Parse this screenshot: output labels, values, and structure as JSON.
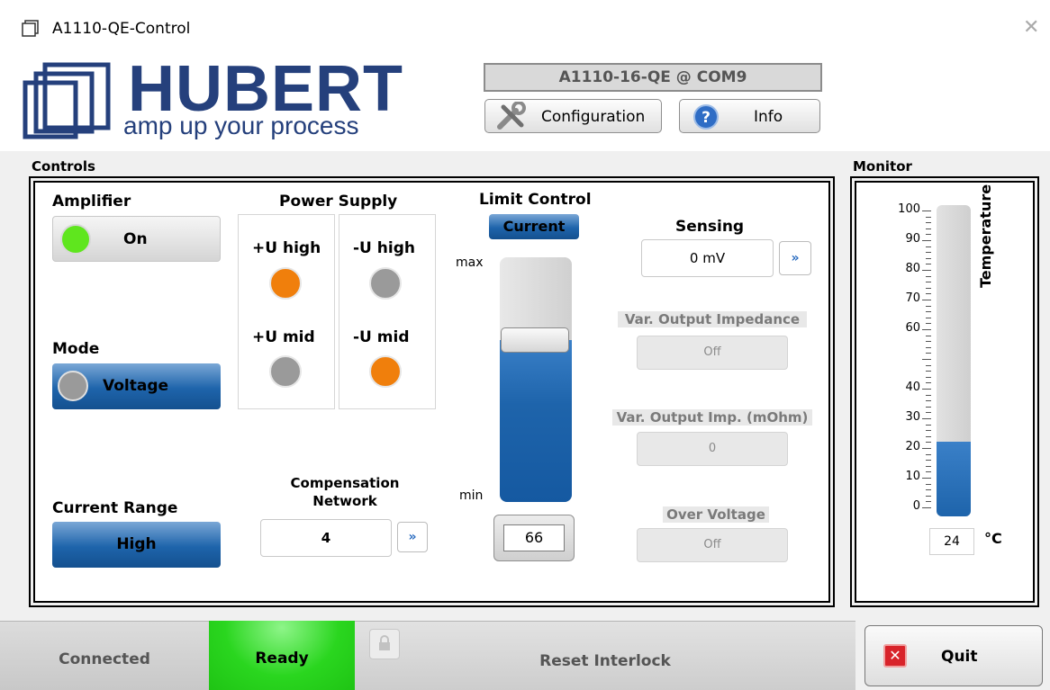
{
  "window": {
    "title": "A1110-QE-Control"
  },
  "brand": {
    "name": "HUBERT",
    "tagline": "amp up your process"
  },
  "header": {
    "device": "A1110-16-QE @ COM9",
    "config_label": "Configuration",
    "info_label": "Info"
  },
  "controls": {
    "section_label": "Controls",
    "amplifier": {
      "label": "Amplifier",
      "button": "On",
      "led_color": "#5fe61e"
    },
    "mode": {
      "label": "Mode",
      "button": "Voltage",
      "led_color": "#9a9a9a"
    },
    "current_range": {
      "label": "Current Range",
      "button": "High"
    },
    "power_supply": {
      "label": "Power Supply",
      "items": [
        {
          "label": "+U high",
          "color": "#f07f0c"
        },
        {
          "label": "-U high",
          "color": "#9a9a9a"
        },
        {
          "label": "+U mid",
          "color": "#9a9a9a"
        },
        {
          "label": "-U mid",
          "color": "#f07f0c"
        }
      ]
    },
    "compensation": {
      "label_line1": "Compensation",
      "label_line2": "Network",
      "value": "4"
    },
    "limit_control": {
      "label": "Limit Control",
      "mode": "Current",
      "max_label": "max",
      "min_label": "min",
      "value": "66",
      "level": 0.66
    },
    "sensing": {
      "label": "Sensing",
      "value": "0 mV"
    },
    "var_output_impedance": {
      "label": "Var. Output Impedance",
      "value": "Off"
    },
    "var_output_imp_mohm": {
      "label": "Var. Output Imp. (mOhm)",
      "value": "0"
    },
    "over_voltage": {
      "label": "Over Voltage",
      "value": "Off"
    }
  },
  "monitor": {
    "section_label": "Monitor",
    "label": "Temperature",
    "ticks": [
      "100",
      "90",
      "80",
      "70",
      "60",
      "40",
      "30",
      "20",
      "10",
      "0"
    ],
    "value": "24",
    "unit": "°C",
    "level": 0.24
  },
  "status": {
    "connected": "Connected",
    "ready": "Ready",
    "reset": "Reset Interlock",
    "quit": "Quit"
  },
  "colors": {
    "brand_blue": "#25407c",
    "accent_blue": "#1e64ab",
    "ready_green": "#2ad61f",
    "quit_red": "#d8232a"
  }
}
